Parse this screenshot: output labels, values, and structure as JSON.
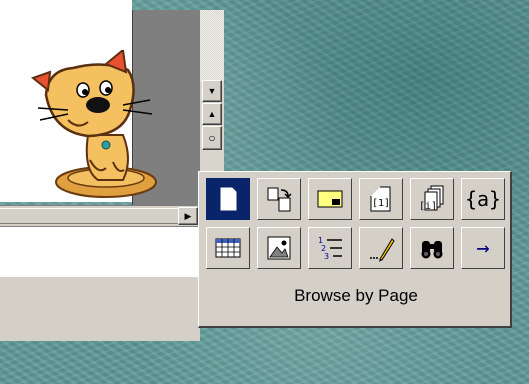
{
  "browse_popup": {
    "caption": "Browse by Page",
    "row1": [
      {
        "id": "page",
        "icon": "page-icon",
        "selected": true
      },
      {
        "id": "section",
        "icon": "section-icon"
      },
      {
        "id": "comment",
        "icon": "comment-icon"
      },
      {
        "id": "footnote",
        "icon": "footnote-icon"
      },
      {
        "id": "endnote",
        "icon": "endnote-icon"
      },
      {
        "id": "field",
        "icon": "field-icon",
        "text": "{a}"
      }
    ],
    "row2": [
      {
        "id": "table",
        "icon": "table-icon"
      },
      {
        "id": "graphic",
        "icon": "graphic-icon"
      },
      {
        "id": "heading",
        "icon": "heading-icon"
      },
      {
        "id": "edits",
        "icon": "edits-icon"
      },
      {
        "id": "find",
        "icon": "find-icon"
      },
      {
        "id": "goto",
        "icon": "go-to-icon",
        "text": "→"
      }
    ]
  },
  "scrollbar": {
    "up_glyph": "▲",
    "down_glyph": "▼",
    "prev_glyph": "▲",
    "browse_glyph": "○",
    "right_glyph": "▶"
  },
  "colors": {
    "selection": "#0a246a",
    "face": "#d4d0c8",
    "desktop": "#5f9c99"
  }
}
